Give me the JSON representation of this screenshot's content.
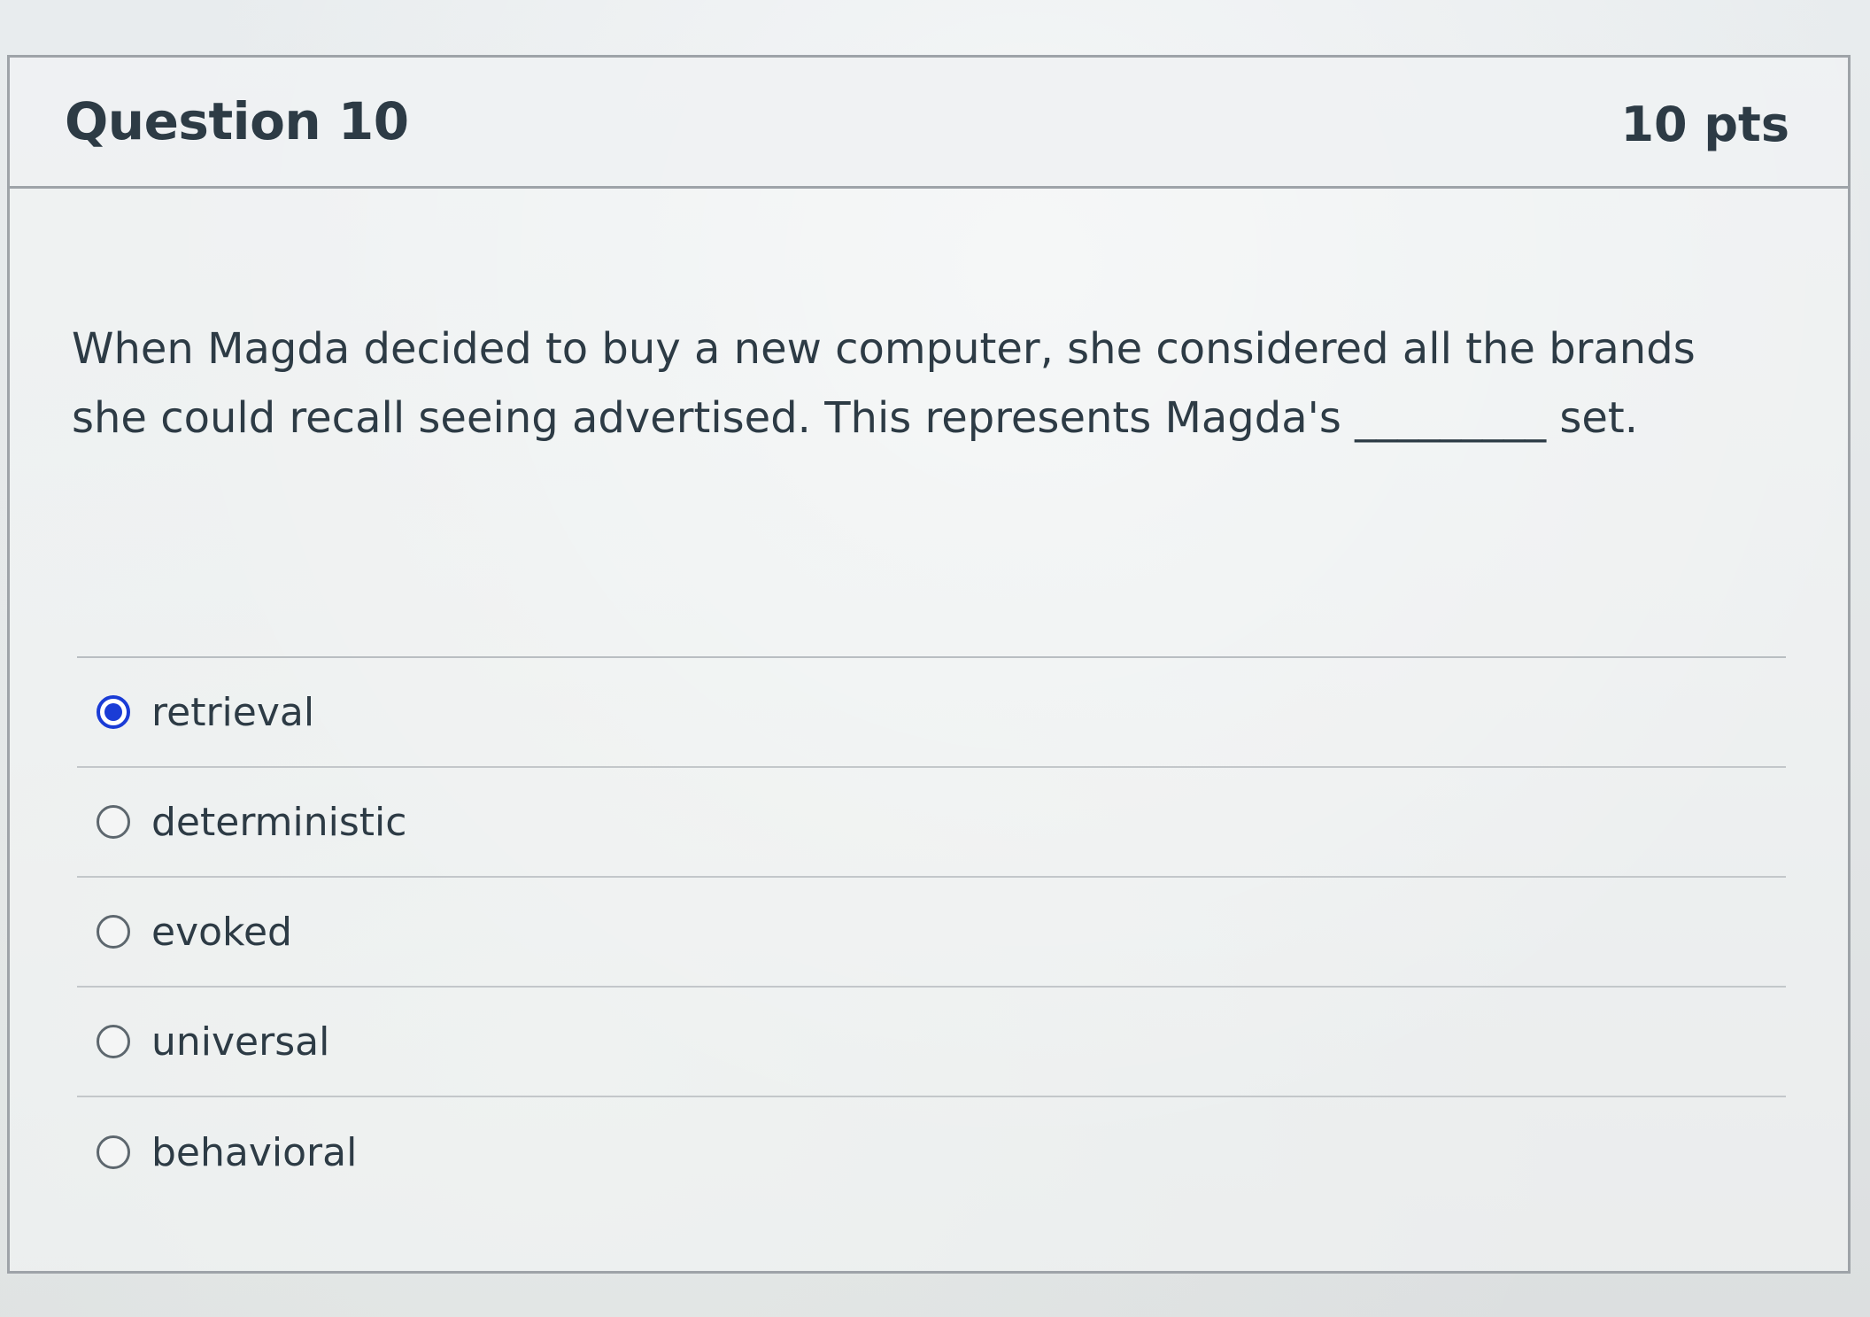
{
  "question": {
    "title": "Question 10",
    "points": "10 pts",
    "text": "When Magda decided to buy a new computer, she considered all the brands she could recall seeing advertised. This represents Magda's _________ set."
  },
  "answers": [
    {
      "label": "retrieval",
      "selected": true
    },
    {
      "label": "deterministic",
      "selected": false
    },
    {
      "label": "evoked",
      "selected": false
    },
    {
      "label": "universal",
      "selected": false
    },
    {
      "label": "behavioral",
      "selected": false
    }
  ],
  "colors": {
    "text": "#2d3b45",
    "radio_selected": "#1a3cd6",
    "border": "#9ea3a8"
  }
}
